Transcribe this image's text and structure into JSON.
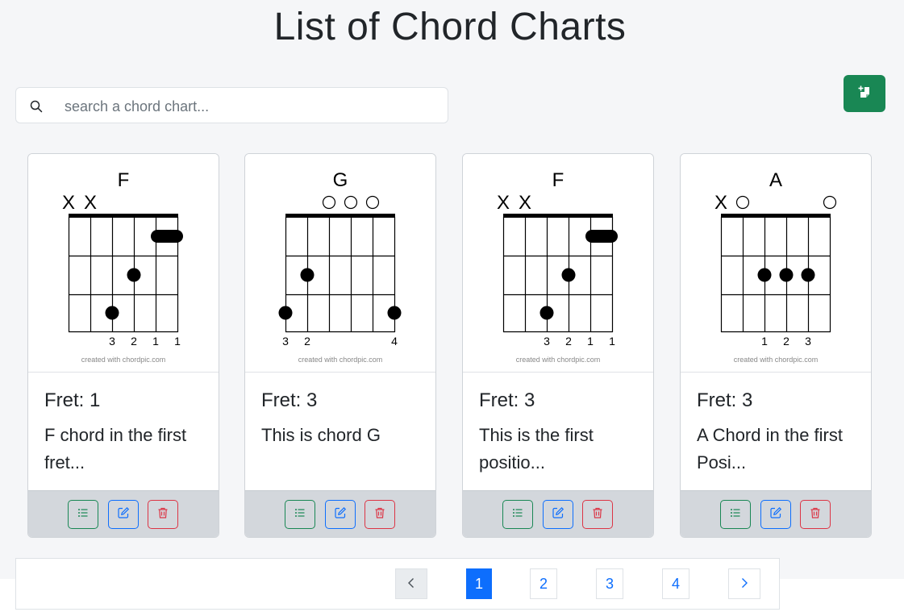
{
  "page": {
    "title": "List of Chord Charts"
  },
  "search": {
    "placeholder": "search a chord chart..."
  },
  "colors": {
    "success": "#198754",
    "primary": "#0d6efd",
    "danger": "#dc3545"
  },
  "icons": {
    "search": "search-icon",
    "add": "add-chart-icon",
    "view": "list-icon",
    "edit": "edit-icon",
    "delete": "trash-icon",
    "prev": "chevron-left-icon",
    "next": "chevron-right-icon"
  },
  "cards": [
    {
      "chord": "F",
      "strings": [
        "X",
        "X",
        "",
        "",
        "",
        ""
      ],
      "fingers": [
        "",
        "",
        "3",
        "2",
        "1",
        "1"
      ],
      "watermark": "created with chordpic.com",
      "fret": "Fret: 1",
      "desc": "F chord in the first fret..."
    },
    {
      "chord": "G",
      "strings": [
        "",
        "",
        "O",
        "O",
        "O",
        ""
      ],
      "fingers": [
        "3",
        "2",
        "",
        "",
        "",
        "4"
      ],
      "watermark": "created with chordpic.com",
      "fret": "Fret: 3",
      "desc": "This is chord G"
    },
    {
      "chord": "F",
      "strings": [
        "X",
        "X",
        "",
        "",
        "",
        ""
      ],
      "fingers": [
        "",
        "",
        "3",
        "2",
        "1",
        "1"
      ],
      "watermark": "created with chordpic.com",
      "fret": "Fret: 3",
      "desc": "This is the first positio..."
    },
    {
      "chord": "A",
      "strings": [
        "X",
        "O",
        "",
        "",
        "",
        "O"
      ],
      "fingers": [
        "",
        "",
        "1",
        "2",
        "3",
        ""
      ],
      "watermark": "created with chordpic.com",
      "fret": "Fret: 3",
      "desc": "A Chord in the first Posi..."
    }
  ],
  "pagination": {
    "pages": [
      "1",
      "2",
      "3",
      "4"
    ],
    "active": "1"
  }
}
